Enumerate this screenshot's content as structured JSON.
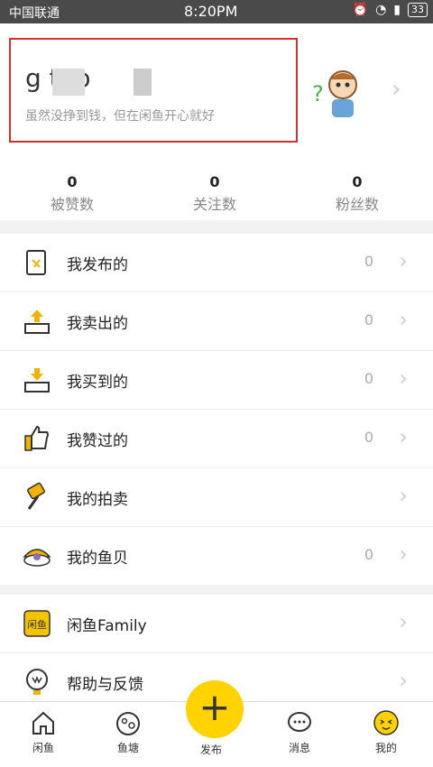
{
  "status": {
    "carrier": "中国联通",
    "time": "8:20PM",
    "battery": "33"
  },
  "profile": {
    "username": "g tuo",
    "tagline": "虽然没挣到钱，但在闲鱼开心就好"
  },
  "stats": [
    {
      "value": "0",
      "label": "被赞数"
    },
    {
      "value": "0",
      "label": "关注数"
    },
    {
      "value": "0",
      "label": "粉丝数"
    }
  ],
  "menu1": [
    {
      "label": "我发布的",
      "count": "0",
      "icon": "publish-doc-icon"
    },
    {
      "label": "我卖出的",
      "count": "0",
      "icon": "box-out-icon"
    },
    {
      "label": "我买到的",
      "count": "0",
      "icon": "box-in-icon"
    },
    {
      "label": "我赞过的",
      "count": "0",
      "icon": "thumbs-up-icon"
    },
    {
      "label": "我的拍卖",
      "count": "",
      "icon": "auction-hammer-icon"
    },
    {
      "label": "我的鱼贝",
      "count": "0",
      "icon": "shell-icon"
    }
  ],
  "menu2": [
    {
      "label": "闲鱼Family",
      "icon": "family-icon"
    },
    {
      "label": "帮助与反馈",
      "icon": "help-bulb-icon"
    }
  ],
  "tabs": [
    {
      "label": "闲鱼",
      "icon": "home-icon"
    },
    {
      "label": "鱼塘",
      "icon": "pond-icon"
    },
    {
      "label": "发布",
      "icon": "plus-icon"
    },
    {
      "label": "消息",
      "icon": "message-icon"
    },
    {
      "label": "我的",
      "icon": "me-face-icon"
    }
  ],
  "colors": {
    "accent": "#ffd200",
    "highlight": "#d63030"
  }
}
